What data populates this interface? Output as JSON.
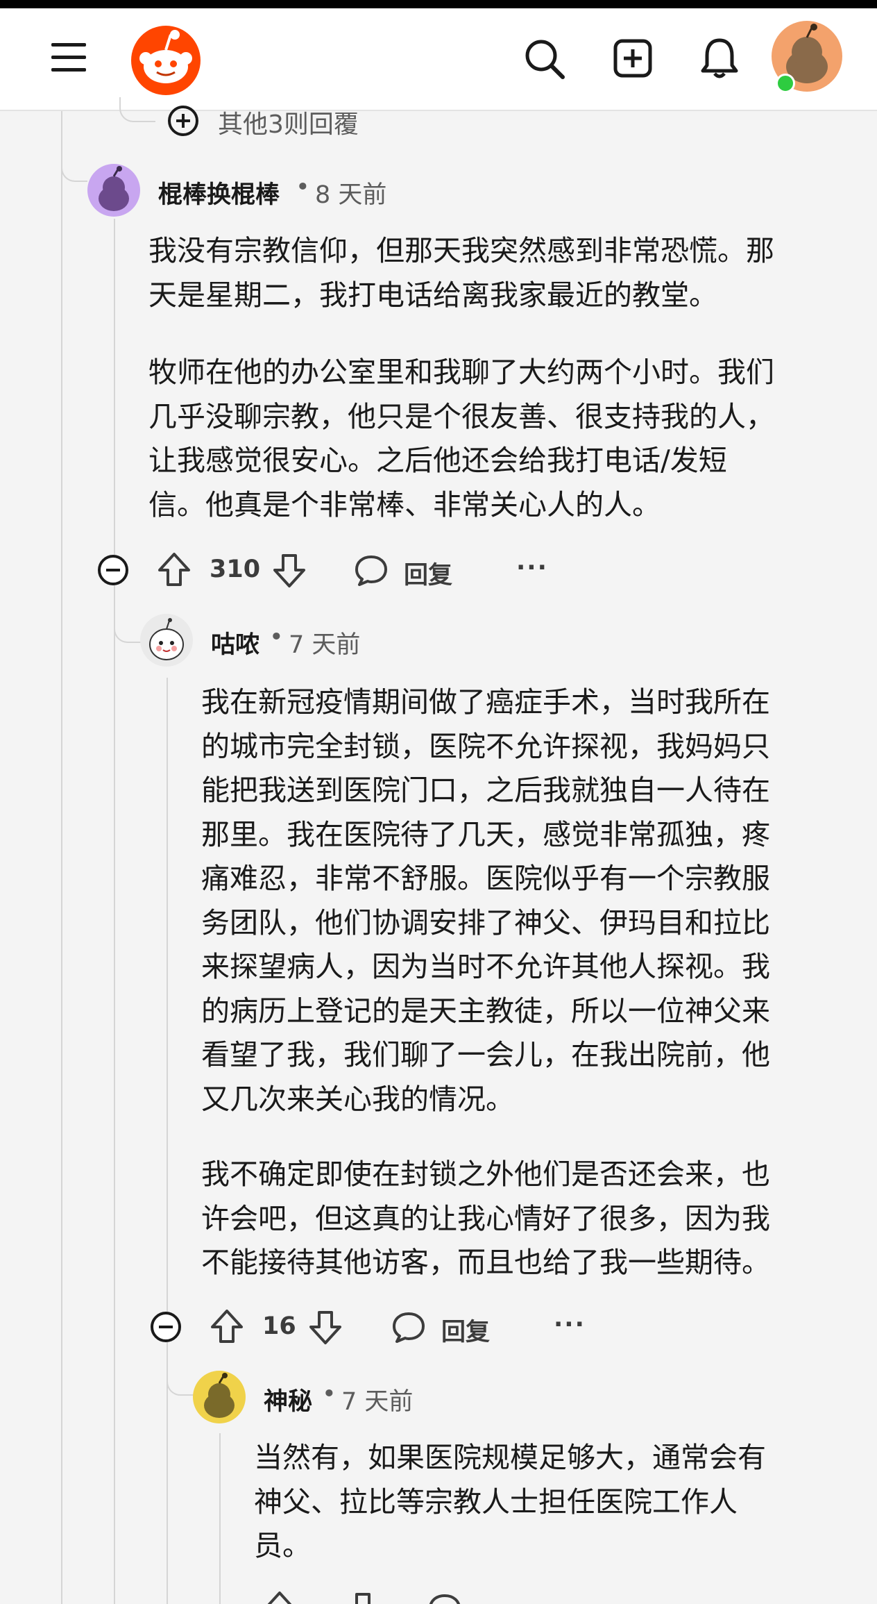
{
  "colors": {
    "brand": "#ff4500",
    "background": "#f4f4f4",
    "online": "#2ecc40"
  },
  "header": {
    "menu_icon": "hamburger-menu-icon",
    "logo_icon": "reddit-snoo-logo",
    "search_icon": "search-icon",
    "create_icon": "create-post-icon",
    "notifications_icon": "bell-icon",
    "avatar_icon": "user-avatar"
  },
  "more_replies": {
    "label": "其他3则回覆"
  },
  "comments": [
    {
      "username": "棍棒换棍棒",
      "time": "8 天前",
      "paragraphs": [
        "我没有宗教信仰，但那天我突然感到非常恐慌。那\n天是星期二，我打电话给离我家最近的教堂。",
        "牧师在他的办公室里和我聊了大约两个小时。我们\n几乎没聊宗教，他只是个很友善、很支持我的人，\n让我感觉很安心。之后他还会给我打电话/发短\n信。他真是个非常棒、非常关心人的人。"
      ],
      "votes": "310",
      "reply_label": "回复",
      "more_label": "···"
    },
    {
      "username": "咕哝",
      "time": "7 天前",
      "paragraphs": [
        "我在新冠疫情期间做了癌症手术，当时我所在\n的城市完全封锁，医院不允许探视，我妈妈只\n能把我送到医院门口，之后我就独自一人待在\n那里。我在医院待了几天，感觉非常孤独，疼\n痛难忍，非常不舒服。医院似乎有一个宗教服\n务团队，他们协调安排了神父、伊玛目和拉比\n来探望病人，因为当时不允许其他人探视。我\n的病历上登记的是天主教徒，所以一位神父来\n看望了我，我们聊了一会儿，在我出院前，他\n又几次来关心我的情况。",
        "我不确定即使在封锁之外他们是否还会来，也\n许会吧，但这真的让我心情好了很多，因为我\n不能接待其他访客，而且也给了我一些期待。"
      ],
      "votes": "16",
      "reply_label": "回复",
      "more_label": "···"
    },
    {
      "username": "神秘",
      "time": "7 天前",
      "paragraphs": [
        "当然有，如果医院规模足够大，通常会有\n神父、拉比等宗教人士担任医院工作人\n员。"
      ]
    }
  ]
}
